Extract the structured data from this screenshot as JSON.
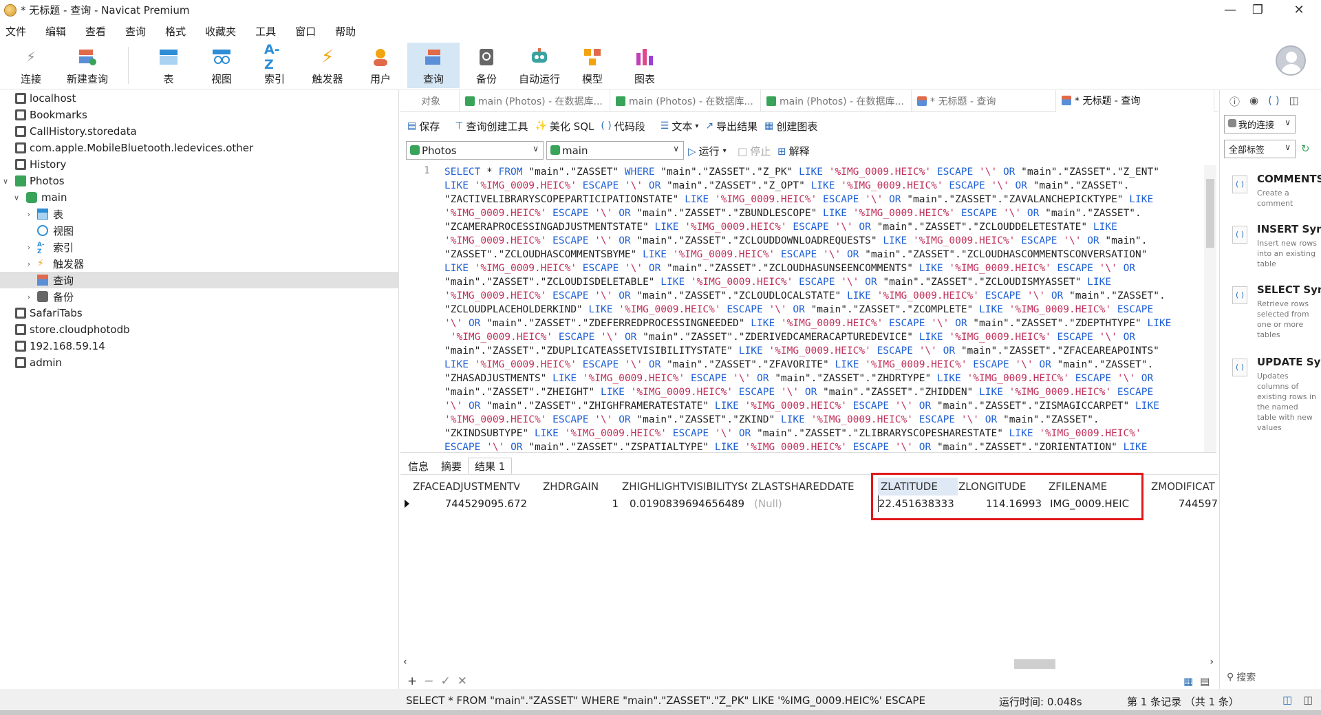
{
  "window": {
    "title": "* 无标题 - 查询 - Navicat Premium"
  },
  "menu": [
    "文件",
    "编辑",
    "查看",
    "查询",
    "格式",
    "收藏夹",
    "工具",
    "窗口",
    "帮助"
  ],
  "toolbar": {
    "buttons": [
      "连接",
      "新建查询",
      "表",
      "视图",
      "索引",
      "触发器",
      "用户",
      "查询",
      "备份",
      "自动运行",
      "模型",
      "图表"
    ],
    "active": "查询"
  },
  "sidebar": {
    "items": [
      "localhost",
      "Bookmarks",
      "CallHistory.storedata",
      "com.apple.MobileBluetooth.ledevices.other",
      "History",
      "Photos",
      "main",
      "表",
      "视图",
      "索引",
      "触发器",
      "查询",
      "备份",
      "SafariTabs",
      "store.cloudphotodb",
      "192.168.59.14",
      "admin"
    ]
  },
  "tabs": [
    "对象",
    "main (Photos) - 在数据库...",
    "main (Photos) - 在数据库...",
    "main (Photos) - 在数据库...",
    "* 无标题 - 查询",
    "* 无标题 - 查询"
  ],
  "query_toolbar": {
    "save": "保存",
    "builder": "查询创建工具",
    "beautify": "美化 SQL",
    "snippet": "代码段",
    "text": "文本",
    "export": "导出结果",
    "chart": "创建图表"
  },
  "selectors": {
    "connection": "Photos",
    "database": "main",
    "run": "运行",
    "stop": "停止",
    "explain": "解释"
  },
  "editor": {
    "line_number": "1",
    "lines": [
      "SELECT * FROM \"main\".\"ZASSET\" WHERE \"main\".\"ZASSET\".\"Z_PK\" LIKE '%IMG_0009.HEIC%' ESCAPE '\\' OR \"main\".\"ZASSET\".\"Z_ENT\"",
      "LIKE '%IMG_0009.HEIC%' ESCAPE '\\' OR \"main\".\"ZASSET\".\"Z_OPT\" LIKE '%IMG_0009.HEIC%' ESCAPE '\\' OR \"main\".\"ZASSET\".",
      "\"ZACTIVELIBRARYSCOPEPARTICIPATIONSTATE\" LIKE '%IMG_0009.HEIC%' ESCAPE '\\' OR \"main\".\"ZASSET\".\"ZAVALANCHEPICKTYPE\" LIKE",
      "'%IMG_0009.HEIC%' ESCAPE '\\' OR \"main\".\"ZASSET\".\"ZBUNDLESCOPE\" LIKE '%IMG_0009.HEIC%' ESCAPE '\\' OR \"main\".\"ZASSET\".",
      "\"ZCAMERAPROCESSINGADJUSTMENTSTATE\" LIKE '%IMG_0009.HEIC%' ESCAPE '\\' OR \"main\".\"ZASSET\".\"ZCLOUDDELETESTATE\" LIKE",
      "'%IMG_0009.HEIC%' ESCAPE '\\' OR \"main\".\"ZASSET\".\"ZCLOUDDOWNLOADREQUESTS\" LIKE '%IMG_0009.HEIC%' ESCAPE '\\' OR \"main\".",
      "\"ZASSET\".\"ZCLOUDHASCOMMENTSBYME\" LIKE '%IMG_0009.HEIC%' ESCAPE '\\' OR \"main\".\"ZASSET\".\"ZCLOUDHASCOMMENTSCONVERSATION\"",
      "LIKE '%IMG_0009.HEIC%' ESCAPE '\\' OR \"main\".\"ZASSET\".\"ZCLOUDHASUNSEENCOMMENTS\" LIKE '%IMG_0009.HEIC%' ESCAPE '\\' OR",
      "\"main\".\"ZASSET\".\"ZCLOUDISDELETABLE\" LIKE '%IMG_0009.HEIC%' ESCAPE '\\' OR \"main\".\"ZASSET\".\"ZCLOUDISMYASSET\" LIKE",
      "'%IMG_0009.HEIC%' ESCAPE '\\' OR \"main\".\"ZASSET\".\"ZCLOUDLOCALSTATE\" LIKE '%IMG_0009.HEIC%' ESCAPE '\\' OR \"main\".\"ZASSET\".",
      "\"ZCLOUDPLACEHOLDERKIND\" LIKE '%IMG_0009.HEIC%' ESCAPE '\\' OR \"main\".\"ZASSET\".\"ZCOMPLETE\" LIKE '%IMG_0009.HEIC%' ESCAPE",
      "'\\' OR \"main\".\"ZASSET\".\"ZDEFERREDPROCESSINGNEEDED\" LIKE '%IMG_0009.HEIC%' ESCAPE '\\' OR \"main\".\"ZASSET\".\"ZDEPTHTYPE\" LIKE",
      " '%IMG_0009.HEIC%' ESCAPE '\\' OR \"main\".\"ZASSET\".\"ZDERIVEDCAMERACAPTUREDEVICE\" LIKE '%IMG_0009.HEIC%' ESCAPE '\\' OR",
      "\"main\".\"ZASSET\".\"ZDUPLICATEASSETVISIBILITYSTATE\" LIKE '%IMG_0009.HEIC%' ESCAPE '\\' OR \"main\".\"ZASSET\".\"ZFACEAREAPOINTS\"",
      "LIKE '%IMG_0009.HEIC%' ESCAPE '\\' OR \"main\".\"ZASSET\".\"ZFAVORITE\" LIKE '%IMG_0009.HEIC%' ESCAPE '\\' OR \"main\".\"ZASSET\".",
      "\"ZHASADJUSTMENTS\" LIKE '%IMG_0009.HEIC%' ESCAPE '\\' OR \"main\".\"ZASSET\".\"ZHDRTYPE\" LIKE '%IMG_0009.HEIC%' ESCAPE '\\' OR",
      "\"main\".\"ZASSET\".\"ZHEIGHT\" LIKE '%IMG_0009.HEIC%' ESCAPE '\\' OR \"main\".\"ZASSET\".\"ZHIDDEN\" LIKE '%IMG_0009.HEIC%' ESCAPE",
      "'\\' OR \"main\".\"ZASSET\".\"ZHIGHFRAMERATESTATE\" LIKE '%IMG_0009.HEIC%' ESCAPE '\\' OR \"main\".\"ZASSET\".\"ZISMAGICCARPET\" LIKE",
      "'%IMG_0009.HEIC%' ESCAPE '\\' OR \"main\".\"ZASSET\".\"ZKIND\" LIKE '%IMG_0009.HEIC%' ESCAPE '\\' OR \"main\".\"ZASSET\".",
      "\"ZKINDSUBTYPE\" LIKE '%IMG_0009.HEIC%' ESCAPE '\\' OR \"main\".\"ZASSET\".\"ZLIBRARYSCOPESHARESTATE\" LIKE '%IMG_0009.HEIC%'",
      "ESCAPE '\\' OR \"main\".\"ZASSET\".\"ZSPATIALTYPE\" LIKE '%IMG_0009.HEIC%' ESCAPE '\\' OR \"main\".\"ZASSET\".\"ZORIENTATION\" LIKE"
    ]
  },
  "result_tabs": [
    "信息",
    "摘要",
    "结果 1"
  ],
  "grid": {
    "columns": [
      "ZFACEADJUSTMENTVERS",
      "ZHDRGAIN",
      "ZHIGHLIGHTVISIBILITYSC",
      "ZLASTSHAREDDATE",
      "ZLATITUDE",
      "ZLONGITUDE",
      "ZFILENAME",
      "ZMODIFICAT"
    ],
    "row": [
      "744529095.672",
      "1",
      "0.0190839694656489",
      "(Null)",
      "22.4516383333",
      "114.16993",
      "IMG_0009.HEIC",
      "744597"
    ]
  },
  "right_panel": {
    "connection_select": "我的连接",
    "tag_select": "全部标签",
    "snippets": [
      {
        "title": "COMMENTS",
        "desc": "Create a comment"
      },
      {
        "title": "INSERT Synt",
        "desc": "Insert new rows into an existing table"
      },
      {
        "title": "SELECT Synt",
        "desc": "Retrieve rows selected from one or more tables"
      },
      {
        "title": "UPDATE Syn",
        "desc": "Updates columns of existing rows in the named table with new values"
      }
    ],
    "search": "搜索"
  },
  "status": {
    "sql": "SELECT * FROM \"main\".\"ZASSET\" WHERE \"main\".\"ZASSET\".\"Z_PK\" LIKE '%IMG_0009.HEIC%' ESCAPE '\\' OF",
    "time": "运行时间: 0.048s",
    "records": "第 1 条记录 （共 1 条）"
  }
}
